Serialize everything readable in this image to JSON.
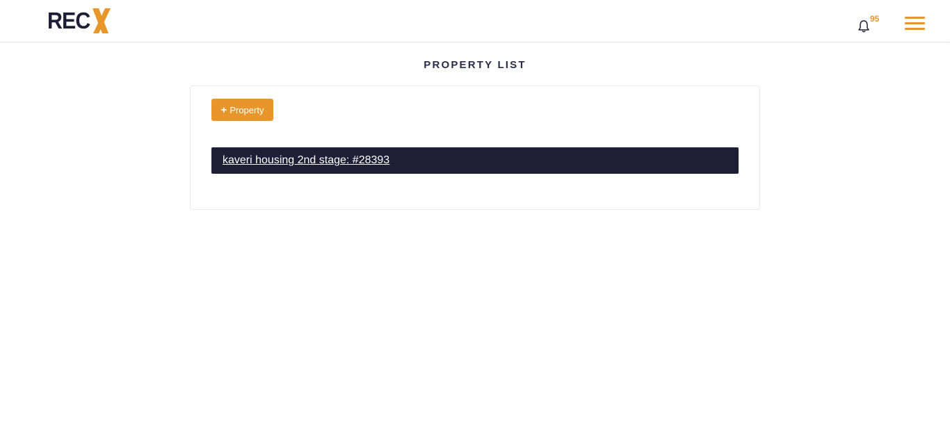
{
  "header": {
    "logo_text": "REC",
    "logo_mark": "X",
    "notification_count": "95",
    "accent_color": "#e8962a",
    "brand_dark": "#1e1f36",
    "icons": {
      "bell": "bell-icon",
      "menu": "hamburger-menu-icon"
    }
  },
  "page": {
    "title": "PROPERTY LIST"
  },
  "toolbar": {
    "add_property_label": "Property",
    "add_icon": "+"
  },
  "properties": [
    {
      "label": "kaveri housing 2nd stage: #28393"
    }
  ]
}
